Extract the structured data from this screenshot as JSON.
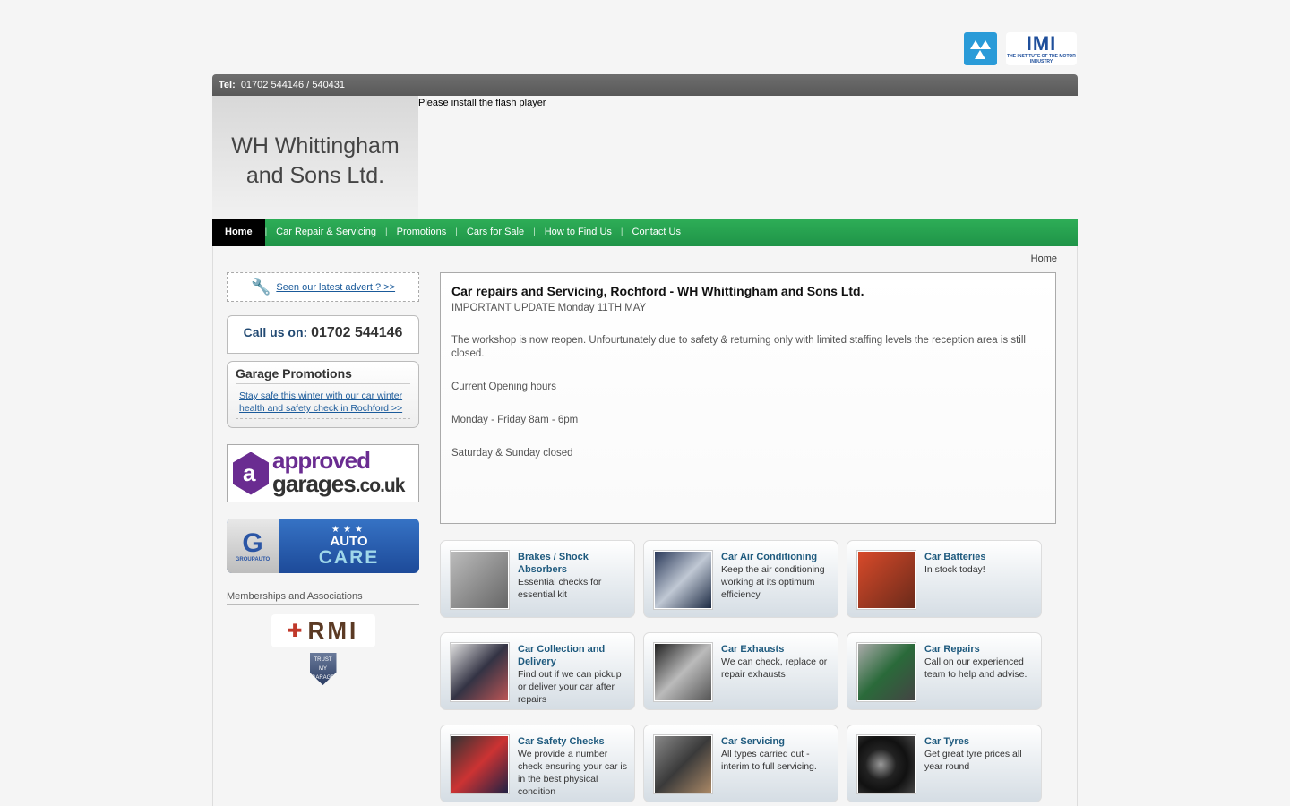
{
  "badges": {
    "imi_big": "IMI",
    "imi_small": "THE INSTITUTE OF THE MOTOR INDUSTRY"
  },
  "topbar": {
    "tel_label": "Tel:",
    "tel_value": "01702 544146 / 540431"
  },
  "header": {
    "logo_line1": "WH Whittingham",
    "logo_line2": "and Sons Ltd.",
    "flash_text": "Please install the flash player"
  },
  "nav": {
    "items": [
      "Home",
      "Car Repair & Servicing",
      "Promotions",
      "Cars for Sale",
      "How to Find Us",
      "Contact Us"
    ]
  },
  "breadcrumb": "Home",
  "sidebar": {
    "advert_link": "Seen our latest advert ? >>",
    "call_label": "Call us on:",
    "call_number": "01702 544146",
    "promo_title": "Garage Promotions",
    "promo_link": "Stay safe this winter with our car winter health and safety check in Rochford >>",
    "approved_line1": "approved",
    "approved_line2": "garages",
    "approved_line3": ".co.uk",
    "groupauto_label": "GROUPAUTO",
    "autocare_line1": "AUTO",
    "autocare_line2": "CARE",
    "members_title": "Memberships and Associations",
    "rmi_text": "RMI",
    "trust_text": "TRUST MY GARAGE"
  },
  "main": {
    "title": "Car repairs and Servicing, Rochford - WH Whittingham and Sons Ltd.",
    "paras": [
      "IMPORTANT UPDATE Monday 11TH MAY",
      "The workshop is now reopen. Unfourtunately due to safety & returning only with limited staffing levels the reception area is still closed.",
      "Current Opening hours",
      "Monday - Friday 8am - 6pm",
      "Saturday & Sunday closed"
    ]
  },
  "cards": [
    {
      "title": "Brakes / Shock Absorbers",
      "desc": "Essential checks for essential kit",
      "thumb": "#8f8f8f"
    },
    {
      "title": "Car Air Conditioning",
      "desc": "Keep the air conditioning working at its optimum efficiency",
      "thumb": "#3a4a6a"
    },
    {
      "title": "Car Batteries",
      "desc": "In stock today!",
      "thumb": "#b83a2a"
    },
    {
      "title": "Car Collection and Delivery",
      "desc": "Find out if we can pickup or deliver your car after repairs",
      "thumb": "#6a6a7a"
    },
    {
      "title": "Car Exhausts",
      "desc": "We can check, replace or repair exhausts",
      "thumb": "#707070"
    },
    {
      "title": "Car Repairs",
      "desc": "Call on our experienced team to help and advise.",
      "thumb": "#5a6a4a"
    },
    {
      "title": "Car Safety Checks",
      "desc": "We provide a number check ensuring your car is in the best physical condition",
      "thumb": "#3a3a5a"
    },
    {
      "title": "Car Servicing",
      "desc": "All types carried out - interim to full servicing.",
      "thumb": "#6a5a4a"
    },
    {
      "title": "Car Tyres",
      "desc": "Get great tyre prices all year round",
      "thumb": "#2a2a2a"
    }
  ]
}
